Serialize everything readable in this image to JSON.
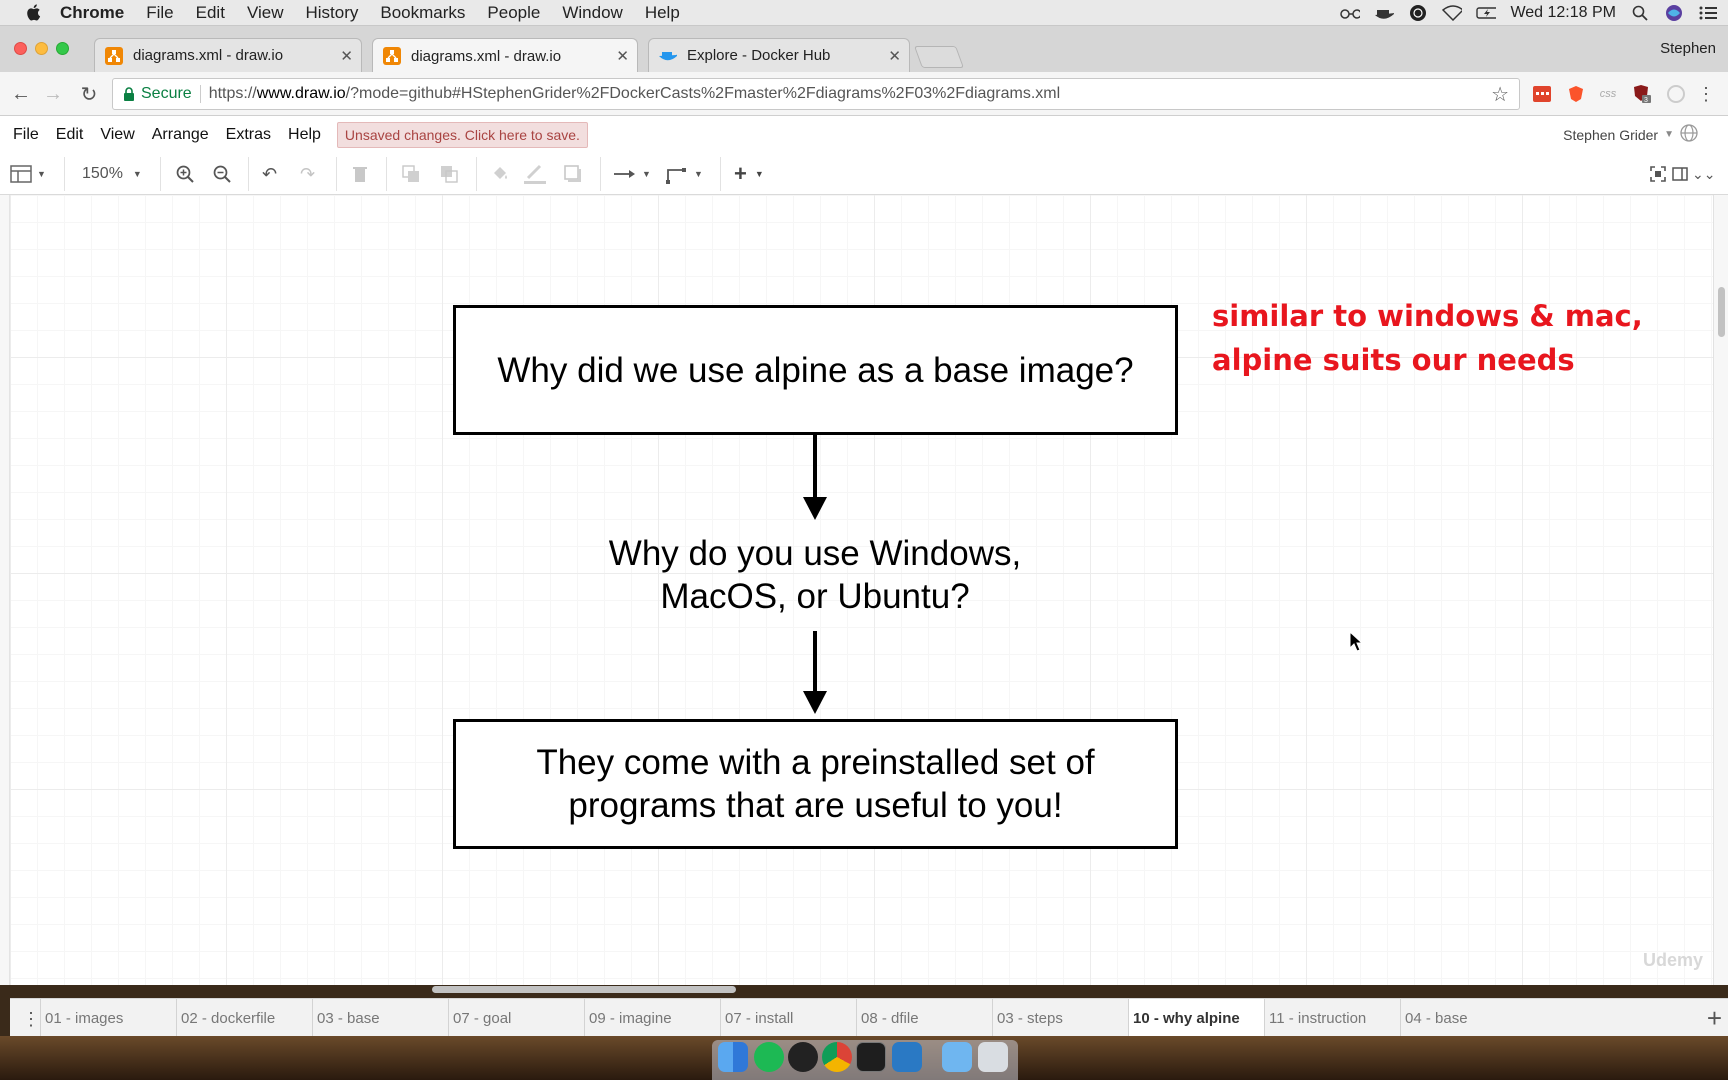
{
  "menubar": {
    "app": "Chrome",
    "items": [
      "File",
      "Edit",
      "View",
      "History",
      "Bookmarks",
      "People",
      "Window",
      "Help"
    ],
    "clock": "Wed 12:18 PM"
  },
  "browser": {
    "tabs": [
      {
        "title": "diagrams.xml - draw.io",
        "icon": "drawio-icon",
        "active": false
      },
      {
        "title": "diagrams.xml - draw.io",
        "icon": "drawio-icon",
        "active": true
      },
      {
        "title": "Explore - Docker Hub",
        "icon": "docker-icon",
        "active": false
      }
    ],
    "profile": "Stephen",
    "secure_label": "Secure",
    "url_scheme": "https://",
    "url_host": "www.draw.io",
    "url_rest": "/?mode=github#HStephenGrider%2FDockerCasts%2Fmaster%2Fdiagrams%2F03%2Fdiagrams.xml",
    "ext_badge": "3"
  },
  "drawio": {
    "menu": [
      "File",
      "Edit",
      "View",
      "Arrange",
      "Extras",
      "Help"
    ],
    "unsaved": "Unsaved changes. Click here to save.",
    "user": "Stephen Grider",
    "zoom": "150%"
  },
  "diagram": {
    "box1": "Why did we use alpine as a base image?",
    "middle_line1": "Why do you use Windows,",
    "middle_line2": "MacOS, or Ubuntu?",
    "box2_line1": "They come with a preinstalled set of",
    "box2_line2": "programs that are useful to you!",
    "annotation_line1": "similar to windows & mac,",
    "annotation_line2": "alpine suits our needs",
    "annotation_color": "#e8161e",
    "watermark": "Udemy"
  },
  "pages": [
    {
      "label": "01 - images",
      "active": false
    },
    {
      "label": "02 - dockerfile",
      "active": false
    },
    {
      "label": "03 - base",
      "active": false
    },
    {
      "label": "07 - goal",
      "active": false
    },
    {
      "label": "09 - imagine",
      "active": false
    },
    {
      "label": "07 - install",
      "active": false
    },
    {
      "label": "08 - dfile",
      "active": false
    },
    {
      "label": "03 - steps",
      "active": false
    },
    {
      "label": "10 - why alpine",
      "active": true
    },
    {
      "label": "11 - instruction",
      "active": false
    },
    {
      "label": "04 - base",
      "active": false
    }
  ]
}
